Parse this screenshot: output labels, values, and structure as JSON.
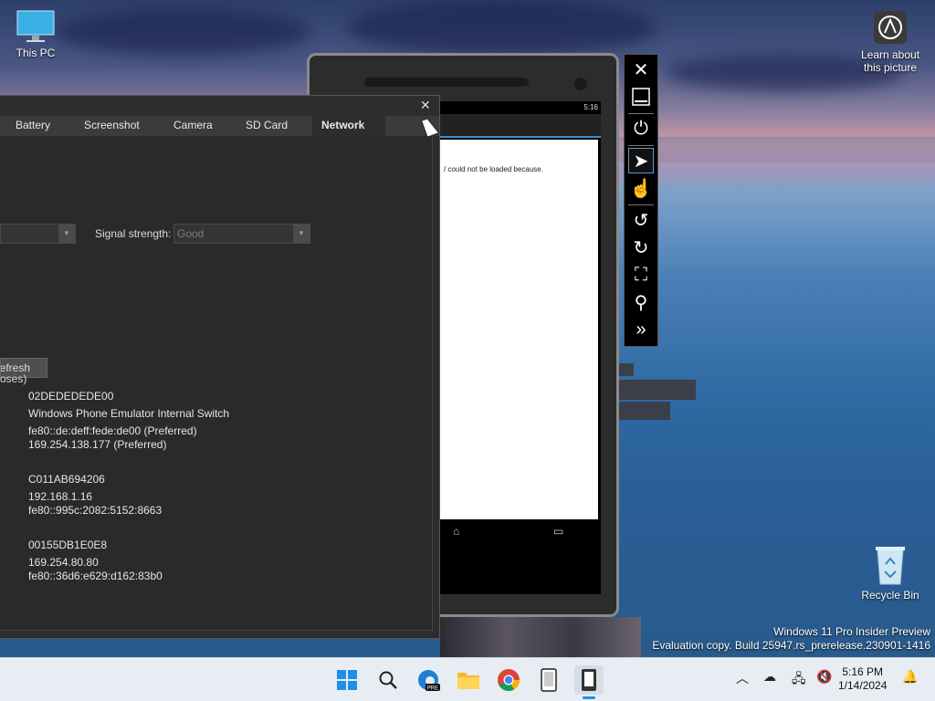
{
  "desktop": {
    "icons": {
      "this_pc": "This PC",
      "learn_picture": "Learn about\nthis picture",
      "recycle_bin": "Recycle Bin"
    },
    "watermark": {
      "line1": "Windows 11 Pro Insider Preview",
      "line2": "Evaluation copy. Build 25947.rs_prerelease.230901-1416"
    }
  },
  "phone": {
    "status_time": "5:16",
    "page_text": "/ could not be loaded because."
  },
  "tools": {
    "tabs": [
      "Battery",
      "Screenshot",
      "Camera",
      "SD Card",
      "Network"
    ],
    "active_tab": "Network",
    "signal_label": "Signal strength:",
    "signal_value": "Good",
    "refresh_label": "Refresh",
    "section_header": "oses)",
    "adapters": [
      {
        "lines": [
          "02DEDEDEDE00",
          "Windows Phone Emulator Internal Switch",
          "fe80::de:deff:fede:de00 (Preferred)",
          "169.254.138.177 (Preferred)"
        ]
      },
      {
        "lines": [
          "C011AB694206",
          "192.168.1.16",
          "fe80::995c:2082:5152:8663"
        ]
      },
      {
        "lines": [
          "00155DB1E0E8",
          "169.254.80.80",
          "fe80::36d6:e629:d162:83b0"
        ]
      }
    ]
  },
  "taskbar": {
    "time": "5:16 PM",
    "date": "1/14/2024",
    "edge_badge": "PRE"
  },
  "colors": {
    "accent": "#3a8ed0",
    "taskbar_bg": "#e8edf4",
    "window_bg": "#2d2d2d"
  }
}
